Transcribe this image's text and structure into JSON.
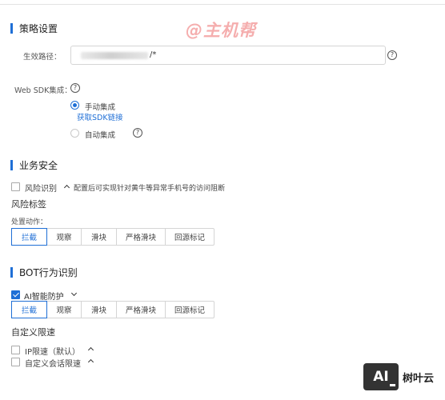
{
  "watermark": "@主机帮",
  "strategy": {
    "title": "策略设置",
    "path_label": "生效路径：",
    "path_value": "/*",
    "sdk_label": "Web SDK集成：",
    "manual_label": "手动集成",
    "get_sdk_link": "获取SDK链接",
    "auto_label": "自动集成",
    "help_glyph": "?"
  },
  "business": {
    "title": "业务安全",
    "risk_identify_label": "风险识别",
    "risk_identify_desc": "配置后可实现针对黄牛等异常手机号的访问阻断",
    "risk_tag_title": "风险标签",
    "action_label": "处置动作：",
    "actions": [
      "拦截",
      "观察",
      "滑块",
      "严格滑块",
      "回源标记"
    ]
  },
  "bot": {
    "title": "BOT行为识别",
    "ai_label": "AI智能防护",
    "actions": [
      "拦截",
      "观察",
      "滑块",
      "严格滑块",
      "回源标记"
    ],
    "custom_rate_title": "自定义限速",
    "ip_rate_label": "IP限速（默认）",
    "session_rate_label": "自定义会话限速"
  },
  "logo": {
    "mark": "AI",
    "text": "树叶云"
  },
  "colors": {
    "accent": "#1f6fd6",
    "watermark": "#ed6b6b"
  }
}
